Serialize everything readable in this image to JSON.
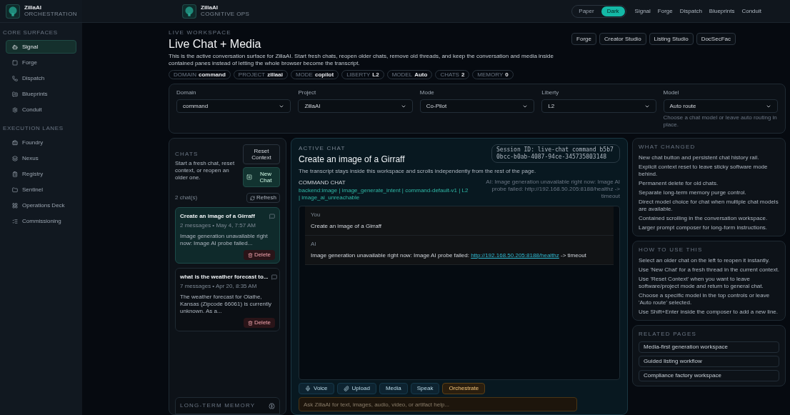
{
  "sidebar": {
    "brand": {
      "name": "ZillaAI",
      "subtitle": "ORCHESTRATION"
    },
    "sections": [
      {
        "title": "CORE SURFACES",
        "items": [
          {
            "label": "Signal",
            "selected": true
          },
          {
            "label": "Forge",
            "selected": false
          },
          {
            "label": "Dispatch",
            "selected": false
          },
          {
            "label": "Blueprints",
            "selected": false
          },
          {
            "label": "Conduit",
            "selected": false
          }
        ]
      },
      {
        "title": "EXECUTION LANES",
        "items": [
          {
            "label": "Foundry",
            "selected": false
          },
          {
            "label": "Nexus",
            "selected": false
          },
          {
            "label": "Registry",
            "selected": false
          },
          {
            "label": "Sentinel",
            "selected": false
          },
          {
            "label": "Operations Deck",
            "selected": false
          },
          {
            "label": "Commissioning",
            "selected": false
          }
        ]
      }
    ]
  },
  "topbar": {
    "brand": {
      "name": "ZillaAI",
      "subtitle": "COGNITIVE OPS"
    },
    "theme_toggle": [
      {
        "label": "Paper",
        "selected": false
      },
      {
        "label": "Dark",
        "selected": true
      }
    ],
    "links": [
      "Signal",
      "Forge",
      "Dispatch",
      "Blueprints",
      "Conduit"
    ]
  },
  "header": {
    "eyebrow": "LIVE WORKSPACE",
    "title": "Live Chat + Media",
    "description": "This is the active conversation surface for ZillaAI. Start fresh chats, reopen older chats, remove old threads, and keep the conversation and media inside contained panes instead of letting the whole browser become the transcript.",
    "chips": [
      {
        "key": "DOMAIN",
        "value": "command"
      },
      {
        "key": "PROJECT",
        "value": "zillaai"
      },
      {
        "key": "MODE",
        "value": "copilot"
      },
      {
        "key": "LIBERTY",
        "value": "L2"
      },
      {
        "key": "MODEL",
        "value": "Auto"
      },
      {
        "key": "CHATS",
        "value": "2"
      },
      {
        "key": "MEMORY",
        "value": "0"
      }
    ],
    "buttons": [
      "Forge",
      "Creator Studio",
      "Listing Studio",
      "DocSecFac"
    ]
  },
  "controls": [
    {
      "label": "Domain",
      "value": "command"
    },
    {
      "label": "Project",
      "value": "ZillaAI"
    },
    {
      "label": "Mode",
      "value": "Co-Pilot"
    },
    {
      "label": "Liberty",
      "value": "L2"
    },
    {
      "label": "Model",
      "value": "Auto route",
      "hint": "Choose a chat model or leave auto routing in place."
    }
  ],
  "chats": {
    "eyebrow": "CHATS",
    "description": "Start a fresh chat, reset context, or reopen an older one.",
    "reset_button": "Reset Context",
    "new_button": "New Chat",
    "count": "2 chat(s)",
    "refresh_button": "Refresh",
    "items": [
      {
        "title": "Create an image of a Girraff",
        "meta": "2 messages • May 4, 7:57 AM",
        "preview": "Image generation unavailable right now: Image AI probe failed...",
        "delete": "Delete",
        "selected": true
      },
      {
        "title": "what is the weather forecast to...",
        "meta": "7 messages • Apr 20, 8:35 AM",
        "preview": "The weather forecast for Olathe, Kansas (Zipcode 66061) is currently unknown. As a...",
        "delete": "Delete",
        "selected": false
      }
    ],
    "memory_title": "LONG-TERM MEMORY"
  },
  "active_chat": {
    "eyebrow": "ACTIVE CHAT",
    "title": "Create an image of a Girraff",
    "subtitle": "The transcript stays inside this workspace and scrolls independently from the rest of the page.",
    "session": "Session ID: live-chat command b5b70bcc-b0ab-4087-94ce-345735803148",
    "mode_label": "COMMAND CHAT",
    "tags": "backend:image | image_generate_intent | command-default-v1 | L2 | image_ai_unreachable",
    "status": "AI: Image generation unavailable right now: Image AI probe failed: http://192.168.50.205:8188/healthz -> timeout",
    "messages": [
      {
        "role": "You",
        "text": "Create an image of a Girraff"
      },
      {
        "role": "AI",
        "text": "Image generation unavailable right now: Image AI probe failed: ",
        "link": "http://192.168.50.205:8188/healthz",
        "after": " -> timeout"
      }
    ],
    "tools": [
      {
        "label": "Voice",
        "kind": "mic"
      },
      {
        "label": "Upload",
        "kind": "clip"
      },
      {
        "label": "Media",
        "kind": "plain"
      },
      {
        "label": "Speak",
        "kind": "plain"
      },
      {
        "label": "Orchestrate",
        "kind": "primary"
      }
    ],
    "composer": {
      "placeholder": "Ask ZillaAI for text, images, audio, video, or artifact help..."
    }
  },
  "side_panels": [
    {
      "kind": "list",
      "title": "WHAT CHANGED",
      "items": [
        "New chat button and persistent chat history rail.",
        "Explicit context reset to leave sticky software mode behind.",
        "Permanent delete for old chats.",
        "Separate long-term memory purge control.",
        "Direct model choice for chat when multiple chat models are available.",
        "Contained scrolling in the conversation workspace.",
        "Larger prompt composer for long-form instructions."
      ]
    },
    {
      "kind": "list",
      "title": "HOW TO USE THIS",
      "items": [
        "Select an older chat on the left to reopen it instantly.",
        "Use 'New Chat' for a fresh thread in the current context.",
        "Use 'Reset Context' when you want to leave software/project mode and return to general chat.",
        "Choose a specific model in the top controls or leave 'Auto route' selected.",
        "Use Shift+Enter inside the composer to add a new line."
      ]
    },
    {
      "kind": "links",
      "title": "RELATED PAGES",
      "items": [
        "Media-first generation workspace",
        "Guided listing workflow",
        "Compliance factory workspace"
      ]
    }
  ]
}
